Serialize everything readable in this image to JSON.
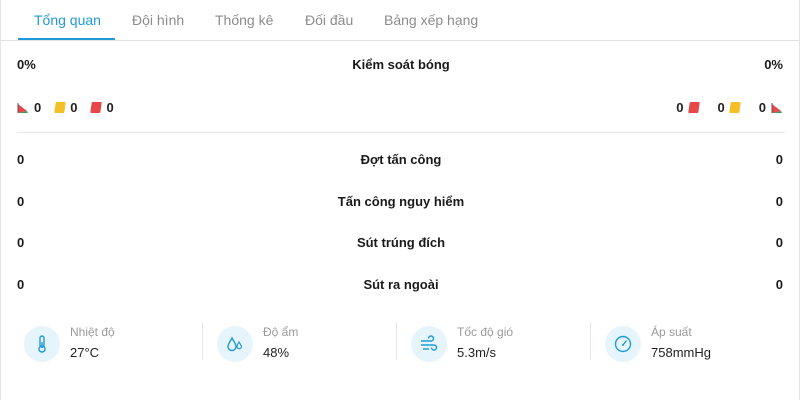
{
  "tabs": [
    {
      "label": "Tổng quan",
      "active": true
    },
    {
      "label": "Đội hình",
      "active": false
    },
    {
      "label": "Thống kê",
      "active": false
    },
    {
      "label": "Đối đầu",
      "active": false
    },
    {
      "label": "Bảng xếp hạng",
      "active": false
    }
  ],
  "possession": {
    "label": "Kiểm soát bóng",
    "home": "0%",
    "away": "0%"
  },
  "cards": {
    "home": {
      "corners": "0",
      "yellow": "0",
      "red": "0"
    },
    "away": {
      "red": "0",
      "yellow": "0",
      "corners": "0"
    }
  },
  "stats": [
    {
      "label": "Đợt tấn công",
      "home": "0",
      "away": "0"
    },
    {
      "label": "Tấn công nguy hiểm",
      "home": "0",
      "away": "0"
    },
    {
      "label": "Sút trúng đích",
      "home": "0",
      "away": "0"
    },
    {
      "label": "Sút ra ngoài",
      "home": "0",
      "away": "0"
    }
  ],
  "weather": [
    {
      "label": "Nhiệt độ",
      "value": "27°C",
      "icon": "thermometer-icon"
    },
    {
      "label": "Độ ẩm",
      "value": "48%",
      "icon": "humidity-icon"
    },
    {
      "label": "Tốc độ gió",
      "value": "5.3m/s",
      "icon": "wind-icon"
    },
    {
      "label": "Áp suất",
      "value": "758mmHg",
      "icon": "pressure-gauge-icon"
    }
  ],
  "colors": {
    "accent": "#1e9bd6",
    "yellow_card": "#f5c027",
    "red_card": "#e84747",
    "icon_bg": "#e6f4fb"
  }
}
